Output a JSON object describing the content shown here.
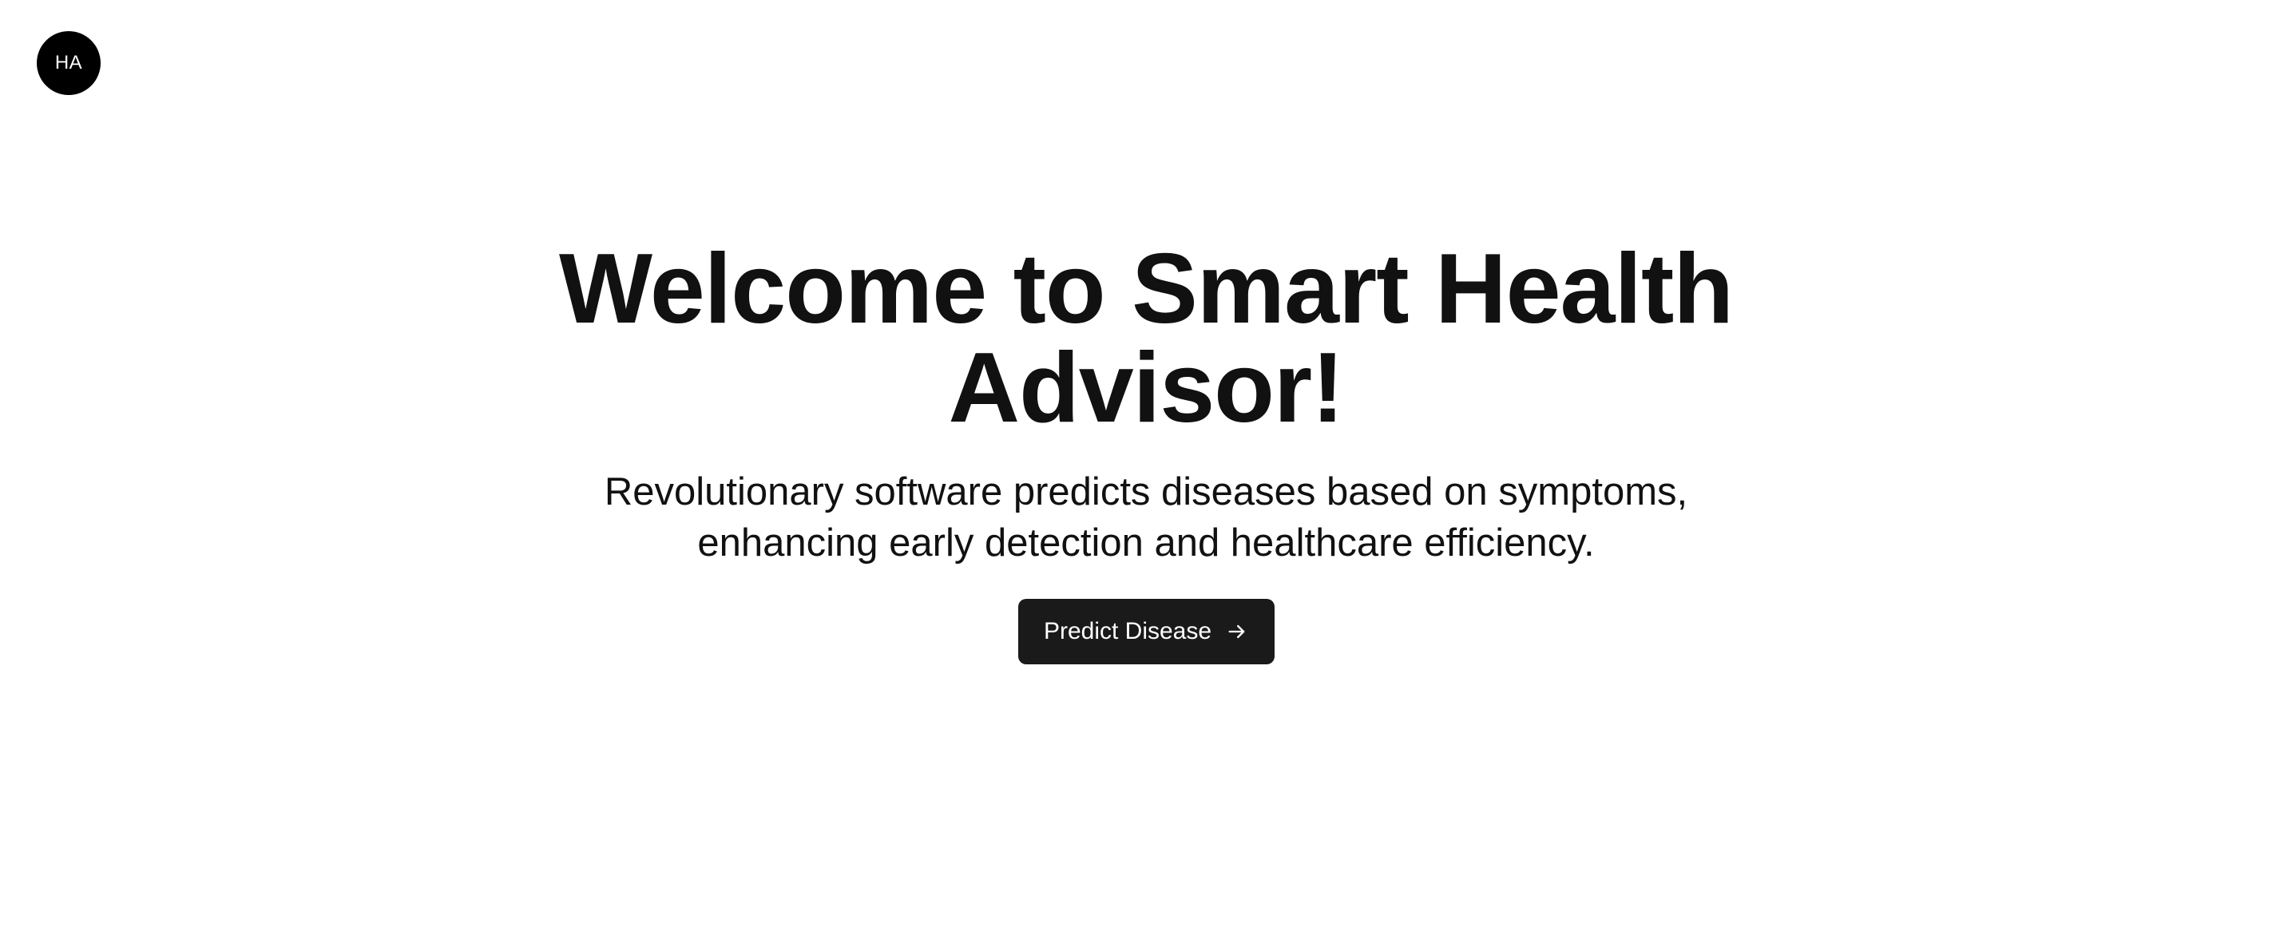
{
  "header": {
    "logo_text": "HA"
  },
  "hero": {
    "title": "Welcome to Smart Health Advisor!",
    "subtitle": "Revolutionary software predicts diseases based on symptoms, enhancing early detection and healthcare efficiency.",
    "cta_label": "Predict Disease",
    "cta_icon": "arrow-right-icon"
  },
  "colors": {
    "background": "#ffffff",
    "text": "#111111",
    "button_background": "#1a1a1a",
    "button_text": "#ffffff",
    "logo_background": "#000000"
  }
}
